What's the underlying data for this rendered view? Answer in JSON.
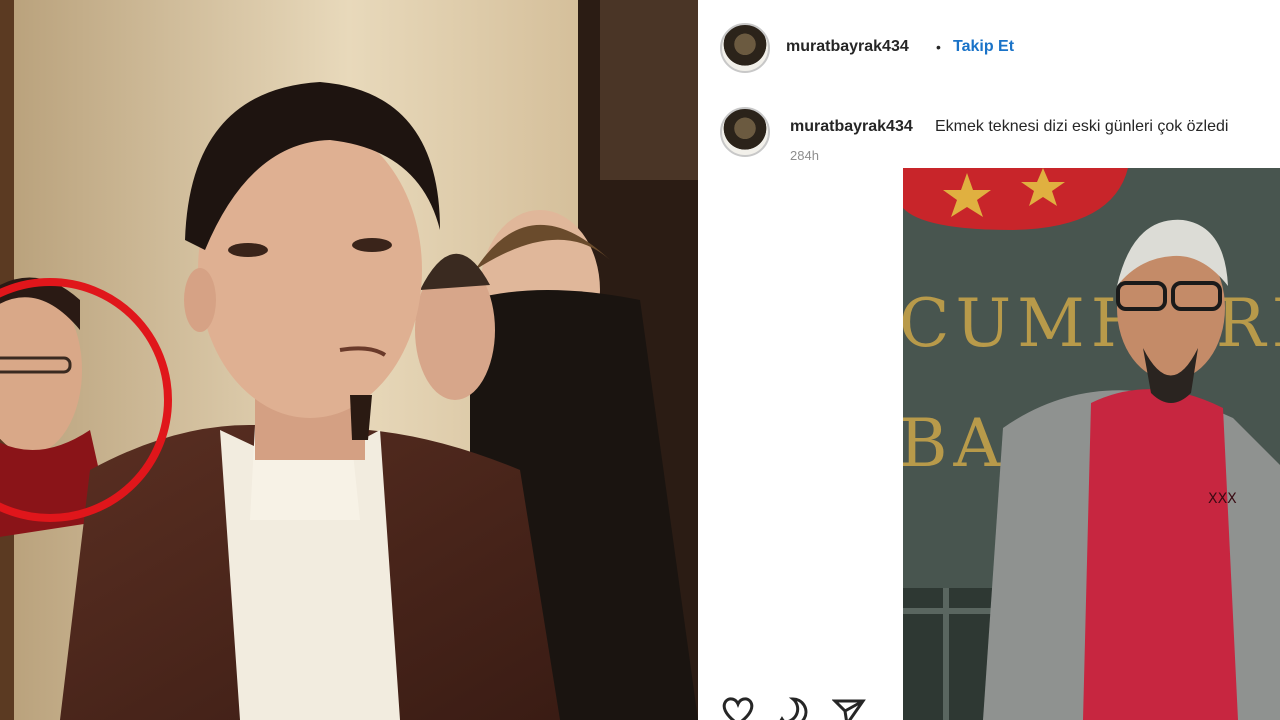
{
  "post": {
    "username": "muratbayrak434",
    "separator": "•",
    "follow_label": "Takip Et",
    "caption": "Ekmek teknesi dizi eski günleri çok özledi",
    "time": "284h",
    "photo_sign_line1": "CUMHURİY",
    "photo_sign_line2": "BAŞ",
    "shirt_text": "XXX"
  },
  "actions": {
    "like_icon": "heart-icon",
    "comment_icon": "comment-icon",
    "share_icon": "share-icon"
  },
  "colors": {
    "follow_blue": "#1a73c8",
    "highlight_circle": "#e0161b"
  }
}
